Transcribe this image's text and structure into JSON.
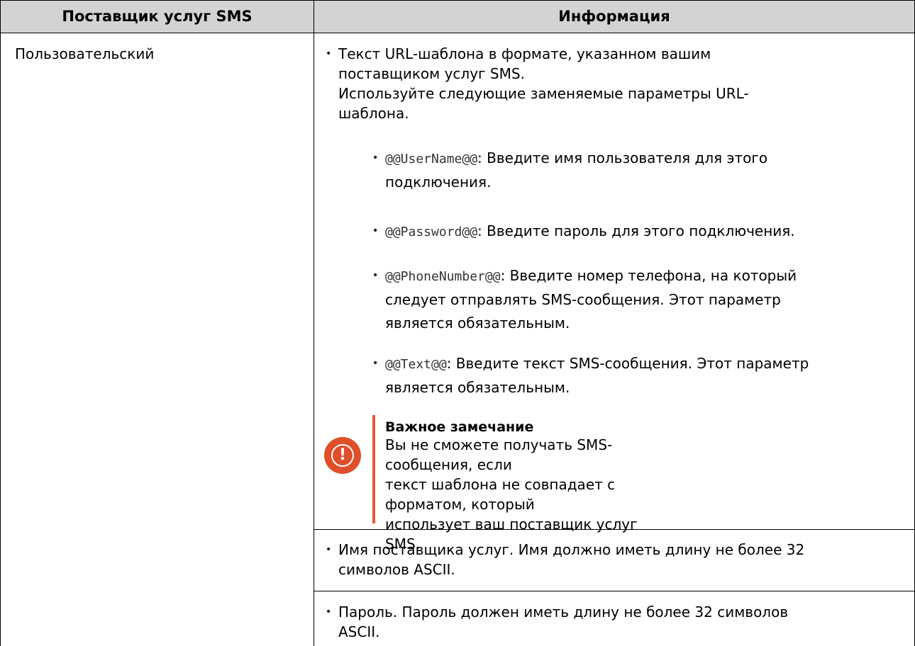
{
  "table": {
    "header": {
      "col1": "Поставщик услуг SMS",
      "col2": "Информация"
    },
    "row": {
      "provider": "Пользовательский",
      "info": {
        "bullet1_line1": "Текст URL-шаблона в формате, указанном вашим",
        "bullet1_line2": "поставщиком услуг SMS.",
        "bullet1_line3": "Используйте следующие заменяемые параметры URL-",
        "bullet1_line4": "шаблона.",
        "params": [
          {
            "code": "@@UserName@@",
            "text1": ": Введите имя пользователя для этого",
            "text2": "подключения.",
            "text3": ""
          },
          {
            "code": "@@Password@@",
            "text1": ": Введите пароль для этого подключения.",
            "text2": "",
            "text3": ""
          },
          {
            "code": "@@PhoneNumber@@",
            "text1": ": Введите номер телефона, на который",
            "text2": "следует отправлять SMS-сообщения. Этот параметр",
            "text3": "является обязательным."
          },
          {
            "code": "@@Text@@",
            "text1": ": Введите текст SMS-сообщения. Этот параметр",
            "text2": "является обязательным.",
            "text3": ""
          }
        ],
        "note": {
          "title": "Важное замечание",
          "line1": "Вы не сможете получать SMS-сообщения, если",
          "line2": "текст шаблона не совпадает с форматом, который",
          "line3": "использует ваш поставщик услуг SMS.",
          "icon": "warning-icon",
          "accent_color": "#e04e2a"
        },
        "bullet2_line1": "Имя поставщика услуг. Имя должно иметь длину не более 32",
        "bullet2_line2": "символов ASCII.",
        "bullet3_line1": "Пароль. Пароль должен иметь длину не более 32 символов",
        "bullet3_line2": "ASCII."
      }
    }
  }
}
